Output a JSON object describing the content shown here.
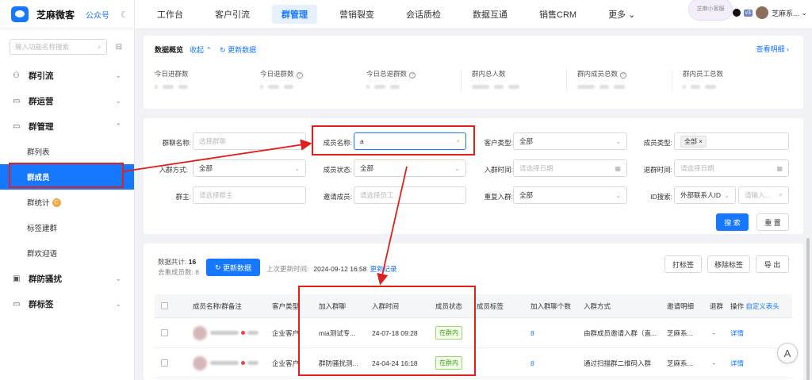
{
  "brand": {
    "name": "芝麻微客",
    "public_account": "公众号",
    "moon_icon": "moon-icon"
  },
  "sidebar": {
    "search_placeholder": "输入功能名称搜索",
    "groups": [
      {
        "label": "群引流",
        "icon": "user-plus-icon",
        "expanded": false
      },
      {
        "label": "群运营",
        "icon": "chat-icon",
        "expanded": false
      },
      {
        "label": "群管理",
        "icon": "chat-icon",
        "expanded": true
      },
      {
        "label": "群防骚扰",
        "icon": "image-icon",
        "expanded": false
      },
      {
        "label": "群标签",
        "icon": "chat-icon",
        "expanded": false
      }
    ],
    "sub_items": [
      "群列表",
      "群成员",
      "群统计",
      "标签建群",
      "群欢迎语"
    ],
    "active_sub": "群成员",
    "badge": "C"
  },
  "topnav": {
    "items": [
      "工作台",
      "客户引流",
      "群管理",
      "营销裂变",
      "会话质检",
      "数据互通",
      "销售CRM",
      "更多"
    ],
    "active": "群管理",
    "user_tag": "v3",
    "user_name": "芝麻系...",
    "bubble_text": "芝麻小客服"
  },
  "overview": {
    "title": "数据概览",
    "collapse": "收起",
    "refresh": "更新数据",
    "detail_link": "查看明细",
    "stats": [
      {
        "label": "今日进群数"
      },
      {
        "label": "今日退群数"
      },
      {
        "label": "今日总退群数"
      },
      {
        "label": "群内总人数"
      },
      {
        "label": "群内成员总数"
      },
      {
        "label": "群内员工总数"
      }
    ]
  },
  "filters": {
    "group_name": {
      "label": "群聊名称:",
      "placeholder": "选择群聊"
    },
    "member_name": {
      "label": "成员名称:",
      "value": "a"
    },
    "customer_type": {
      "label": "客户类型:",
      "value": "全部"
    },
    "member_type": {
      "label": "成员类型:",
      "value": "全部"
    },
    "join_method": {
      "label": "入群方式:",
      "value": "全部"
    },
    "member_status": {
      "label": "成员状态:",
      "value": "全部"
    },
    "join_time": {
      "label": "入群时间:",
      "placeholder": "请选择日期"
    },
    "leave_time": {
      "label": "退群时间:",
      "placeholder": "请选择日期"
    },
    "owner": {
      "label": "群主:",
      "placeholder": "请选择群主"
    },
    "inviter": {
      "label": "邀请成员:",
      "placeholder": "请选择员工"
    },
    "rejoin": {
      "label": "重复入群:",
      "value": "全部"
    },
    "id_search": {
      "label": "ID搜索:",
      "type": "外部联系人ID",
      "placeholder": "请输入..."
    },
    "search_btn": "搜 索",
    "reset_btn": "重 置"
  },
  "list": {
    "total_label": "数据共计:",
    "total": "16",
    "dedupe_label": "去重成员数:",
    "dedupe": "8",
    "refresh_btn": "更新数据",
    "last_update_label": "上次更新时间:",
    "last_update": "2024-09-12 16:58",
    "update_log": "更新记录",
    "tag_btn": "打标签",
    "remove_tag_btn": "移除标签",
    "export_btn": "导 出",
    "columns": [
      "成员名称/群备注",
      "客户类型",
      "加入群聊",
      "入群时间",
      "成员状态",
      "成员标签",
      "加入群聊个数",
      "入群方式",
      "邀请明细",
      "退群",
      "操作",
      "自定义表头"
    ],
    "rows": [
      {
        "customer_type": "企业客户",
        "group": "mia测试专...",
        "join_time": "24-07-18 09:28",
        "status": "在群内",
        "tag": "",
        "count": "8",
        "method": "由群成员邀请入群（直...",
        "inviter": "芝麻系...",
        "leave": "-",
        "action": "详情"
      },
      {
        "customer_type": "企业客户",
        "group": "群防骚扰测...",
        "join_time": "24-04-24 16:18",
        "status": "在群内",
        "tag": "",
        "count": "8",
        "method": "通过扫描群二维码入群",
        "inviter": "芝麻系...",
        "leave": "-",
        "action": "详情"
      }
    ]
  },
  "colors": {
    "accent": "#1677ff",
    "annotation": "#e0201c",
    "status_green": "#389e0d"
  }
}
